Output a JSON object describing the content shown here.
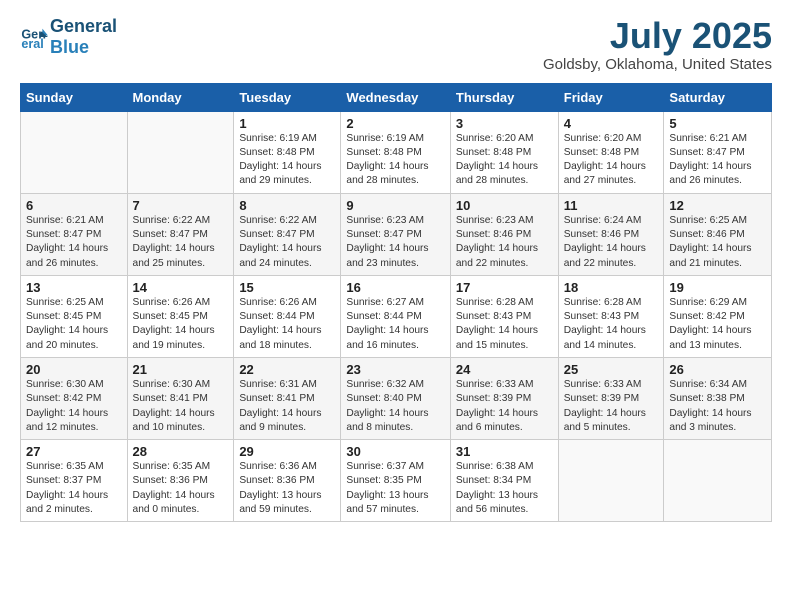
{
  "header": {
    "logo_line1": "General",
    "logo_line2": "Blue",
    "month_year": "July 2025",
    "location": "Goldsby, Oklahoma, United States"
  },
  "weekdays": [
    "Sunday",
    "Monday",
    "Tuesday",
    "Wednesday",
    "Thursday",
    "Friday",
    "Saturday"
  ],
  "weeks": [
    [
      {
        "day": "",
        "content": ""
      },
      {
        "day": "",
        "content": ""
      },
      {
        "day": "1",
        "content": "Sunrise: 6:19 AM\nSunset: 8:48 PM\nDaylight: 14 hours and 29 minutes."
      },
      {
        "day": "2",
        "content": "Sunrise: 6:19 AM\nSunset: 8:48 PM\nDaylight: 14 hours and 28 minutes."
      },
      {
        "day": "3",
        "content": "Sunrise: 6:20 AM\nSunset: 8:48 PM\nDaylight: 14 hours and 28 minutes."
      },
      {
        "day": "4",
        "content": "Sunrise: 6:20 AM\nSunset: 8:48 PM\nDaylight: 14 hours and 27 minutes."
      },
      {
        "day": "5",
        "content": "Sunrise: 6:21 AM\nSunset: 8:47 PM\nDaylight: 14 hours and 26 minutes."
      }
    ],
    [
      {
        "day": "6",
        "content": "Sunrise: 6:21 AM\nSunset: 8:47 PM\nDaylight: 14 hours and 26 minutes."
      },
      {
        "day": "7",
        "content": "Sunrise: 6:22 AM\nSunset: 8:47 PM\nDaylight: 14 hours and 25 minutes."
      },
      {
        "day": "8",
        "content": "Sunrise: 6:22 AM\nSunset: 8:47 PM\nDaylight: 14 hours and 24 minutes."
      },
      {
        "day": "9",
        "content": "Sunrise: 6:23 AM\nSunset: 8:47 PM\nDaylight: 14 hours and 23 minutes."
      },
      {
        "day": "10",
        "content": "Sunrise: 6:23 AM\nSunset: 8:46 PM\nDaylight: 14 hours and 22 minutes."
      },
      {
        "day": "11",
        "content": "Sunrise: 6:24 AM\nSunset: 8:46 PM\nDaylight: 14 hours and 22 minutes."
      },
      {
        "day": "12",
        "content": "Sunrise: 6:25 AM\nSunset: 8:46 PM\nDaylight: 14 hours and 21 minutes."
      }
    ],
    [
      {
        "day": "13",
        "content": "Sunrise: 6:25 AM\nSunset: 8:45 PM\nDaylight: 14 hours and 20 minutes."
      },
      {
        "day": "14",
        "content": "Sunrise: 6:26 AM\nSunset: 8:45 PM\nDaylight: 14 hours and 19 minutes."
      },
      {
        "day": "15",
        "content": "Sunrise: 6:26 AM\nSunset: 8:44 PM\nDaylight: 14 hours and 18 minutes."
      },
      {
        "day": "16",
        "content": "Sunrise: 6:27 AM\nSunset: 8:44 PM\nDaylight: 14 hours and 16 minutes."
      },
      {
        "day": "17",
        "content": "Sunrise: 6:28 AM\nSunset: 8:43 PM\nDaylight: 14 hours and 15 minutes."
      },
      {
        "day": "18",
        "content": "Sunrise: 6:28 AM\nSunset: 8:43 PM\nDaylight: 14 hours and 14 minutes."
      },
      {
        "day": "19",
        "content": "Sunrise: 6:29 AM\nSunset: 8:42 PM\nDaylight: 14 hours and 13 minutes."
      }
    ],
    [
      {
        "day": "20",
        "content": "Sunrise: 6:30 AM\nSunset: 8:42 PM\nDaylight: 14 hours and 12 minutes."
      },
      {
        "day": "21",
        "content": "Sunrise: 6:30 AM\nSunset: 8:41 PM\nDaylight: 14 hours and 10 minutes."
      },
      {
        "day": "22",
        "content": "Sunrise: 6:31 AM\nSunset: 8:41 PM\nDaylight: 14 hours and 9 minutes."
      },
      {
        "day": "23",
        "content": "Sunrise: 6:32 AM\nSunset: 8:40 PM\nDaylight: 14 hours and 8 minutes."
      },
      {
        "day": "24",
        "content": "Sunrise: 6:33 AM\nSunset: 8:39 PM\nDaylight: 14 hours and 6 minutes."
      },
      {
        "day": "25",
        "content": "Sunrise: 6:33 AM\nSunset: 8:39 PM\nDaylight: 14 hours and 5 minutes."
      },
      {
        "day": "26",
        "content": "Sunrise: 6:34 AM\nSunset: 8:38 PM\nDaylight: 14 hours and 3 minutes."
      }
    ],
    [
      {
        "day": "27",
        "content": "Sunrise: 6:35 AM\nSunset: 8:37 PM\nDaylight: 14 hours and 2 minutes."
      },
      {
        "day": "28",
        "content": "Sunrise: 6:35 AM\nSunset: 8:36 PM\nDaylight: 14 hours and 0 minutes."
      },
      {
        "day": "29",
        "content": "Sunrise: 6:36 AM\nSunset: 8:36 PM\nDaylight: 13 hours and 59 minutes."
      },
      {
        "day": "30",
        "content": "Sunrise: 6:37 AM\nSunset: 8:35 PM\nDaylight: 13 hours and 57 minutes."
      },
      {
        "day": "31",
        "content": "Sunrise: 6:38 AM\nSunset: 8:34 PM\nDaylight: 13 hours and 56 minutes."
      },
      {
        "day": "",
        "content": ""
      },
      {
        "day": "",
        "content": ""
      }
    ]
  ]
}
